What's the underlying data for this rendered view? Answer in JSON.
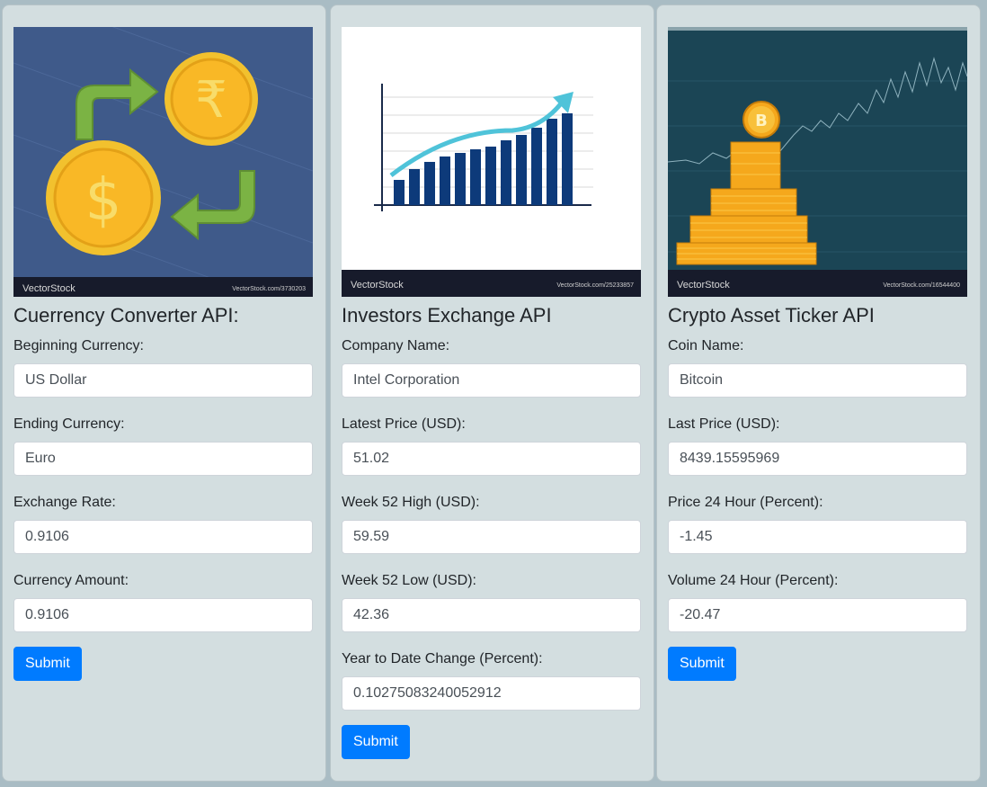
{
  "cards": [
    {
      "title": "Cuerrency Converter API:",
      "image": {
        "subject": "currency-exchange-coins",
        "brand": "VectorStock",
        "ref": "VectorStock.com/3730203",
        "coin_top_symbol": "₹",
        "coin_bottom_symbol": "$"
      },
      "fields": [
        {
          "label": "Beginning Currency:",
          "value": "US Dollar"
        },
        {
          "label": "Ending Currency:",
          "value": "Euro"
        },
        {
          "label": "Exchange Rate:",
          "value": "0.9106"
        },
        {
          "label": "Currency Amount:",
          "value": "0.9106"
        }
      ],
      "submit_label": "Submit"
    },
    {
      "title": "Investors Exchange API",
      "image": {
        "subject": "growth-bar-chart",
        "brand": "VectorStock",
        "ref": "VectorStock.com/25233857"
      },
      "fields": [
        {
          "label": "Company Name:",
          "value": "Intel Corporation"
        },
        {
          "label": "Latest Price (USD):",
          "value": "51.02"
        },
        {
          "label": "Week 52 High (USD):",
          "value": "59.59"
        },
        {
          "label": "Week 52 Low (USD):",
          "value": "42.36"
        },
        {
          "label": "Year to Date Change (Percent):",
          "value": "0.10275083240052912"
        }
      ],
      "submit_label": "Submit"
    },
    {
      "title": "Crypto Asset Ticker API",
      "image": {
        "subject": "bitcoin-coin-stacks",
        "brand": "VectorStock",
        "ref": "VectorStock.com/16544400",
        "coin_symbol": "B"
      },
      "fields": [
        {
          "label": "Coin Name:",
          "value": "Bitcoin"
        },
        {
          "label": "Last Price (USD):",
          "value": "8439.15595969"
        },
        {
          "label": "Price 24 Hour (Percent):",
          "value": "-1.45"
        },
        {
          "label": "Volume 24 Hour (Percent):",
          "value": "-20.47"
        }
      ],
      "submit_label": "Submit"
    }
  ],
  "colors": {
    "page_bg": "#a9bcc4",
    "card_bg": "#d3dee0",
    "button": "#007bff",
    "coin_gold": "#f9b826",
    "arrow_green": "#7bb344",
    "chart_bar": "#0d3a7a",
    "chart_arrow": "#4fc3d9"
  }
}
